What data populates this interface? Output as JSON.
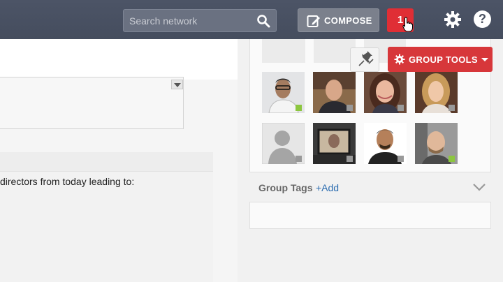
{
  "header": {
    "search_placeholder": "Search network",
    "compose_label": "COMPOSE",
    "notification_count": "1",
    "help_label": "?"
  },
  "feed": {
    "post_text": "directors from today leading to:"
  },
  "group": {
    "tools_label": "GROUP TOOLS",
    "tags_title": "Group Tags",
    "tags_add": "+Add",
    "members": [
      {
        "status": "online"
      },
      {
        "status": "offline"
      },
      {
        "status": "offline"
      },
      {
        "status": "offline"
      },
      {
        "status": "offline"
      },
      {
        "status": "offline"
      },
      {
        "status": "offline"
      },
      {
        "status": "online"
      }
    ]
  },
  "colors": {
    "topbar": "#4a5263",
    "accent_red": "#d7373a",
    "online": "#8cc63f",
    "offline": "#999999",
    "link": "#2b6cb0"
  },
  "icons": [
    "search-icon",
    "pencil-icon",
    "gear-icon",
    "help-icon",
    "pin-icon",
    "chevron-down-icon",
    "cursor-hand-icon"
  ]
}
